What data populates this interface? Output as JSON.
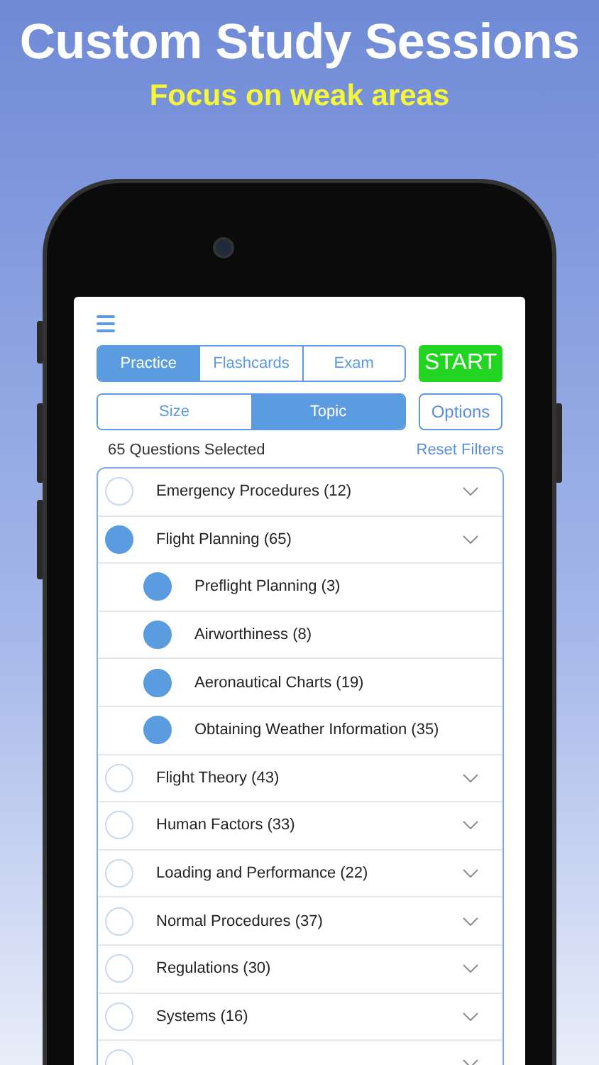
{
  "headline": "Custom Study Sessions",
  "subheadline": "Focus on weak areas",
  "mode_tabs": [
    {
      "label": "Practice",
      "selected": true
    },
    {
      "label": "Flashcards",
      "selected": false
    },
    {
      "label": "Exam",
      "selected": false
    }
  ],
  "start_button": "START",
  "filter_tabs": [
    {
      "label": "Size",
      "selected": false
    },
    {
      "label": "Topic",
      "selected": true
    }
  ],
  "options_button": "Options",
  "selection_count": "65 Questions Selected",
  "reset_link": "Reset Filters",
  "topics": [
    {
      "label": "Emergency Procedures (12)",
      "checked": false
    },
    {
      "label": "Flight Planning (65)",
      "checked": true,
      "children": [
        {
          "label": "Preflight Planning (3)",
          "checked": true
        },
        {
          "label": "Airworthiness (8)",
          "checked": true
        },
        {
          "label": "Aeronautical Charts (19)",
          "checked": true
        },
        {
          "label": "Obtaining Weather Information (35)",
          "checked": true
        }
      ]
    },
    {
      "label": "Flight Theory (43)",
      "checked": false
    },
    {
      "label": "Human Factors (33)",
      "checked": false
    },
    {
      "label": "Loading and Performance (22)",
      "checked": false
    },
    {
      "label": "Normal Procedures (37)",
      "checked": false
    },
    {
      "label": "Regulations (30)",
      "checked": false
    },
    {
      "label": "Systems (16)",
      "checked": false
    },
    {
      "checked": false
    }
  ]
}
